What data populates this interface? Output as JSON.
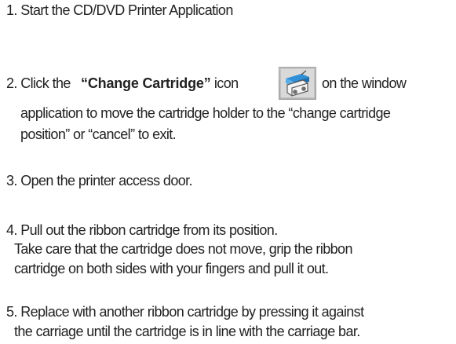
{
  "steps": {
    "s1": "1. Start the CD/DVD Printer Application",
    "s2_pre": "2. Click the",
    "s2_bold": "“Change Cartridge”",
    "s2_mid": "icon",
    "s2_post": "on the window",
    "s2_l2": "application to move the cartridge holder to the “change cartridge",
    "s2_l3": "position” or “cancel” to exit.",
    "s3": "3. Open the printer access door.",
    "s4_l1": "4. Pull out the ribbon cartridge from its position.",
    "s4_l2": "Take care that the cartridge does not move, grip the ribbon",
    "s4_l3": "cartridge on both sides with your fingers  and pull it out.",
    "s5_l1": "5. Replace with another ribbon cartridge by pressing it against",
    "s5_l2": "the carriage until the cartridge is  in line with the carriage bar."
  },
  "icon": {
    "name": "change-cartridge-icon",
    "accent": "#2f8fd8"
  }
}
